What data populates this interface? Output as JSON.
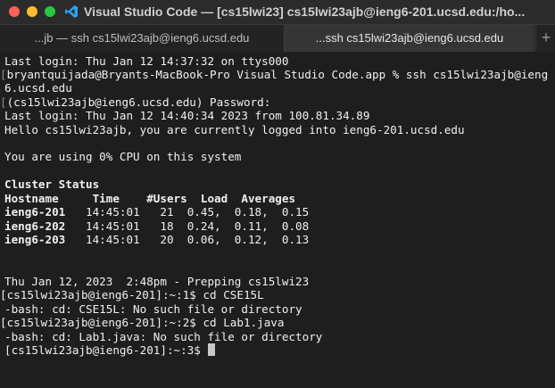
{
  "window": {
    "title": "Visual Studio Code — [cs15lwi23]  cs15lwi23ajb@ieng6-201.ucsd.edu:/ho..."
  },
  "tabs": [
    {
      "label": "...jb — ssh cs15lwi23ajb@ieng6.ucsd.edu",
      "active": false
    },
    {
      "label": "...ssh cs15lwi23ajb@ieng6.ucsd.edu",
      "active": true
    }
  ],
  "tab_add_label": "+",
  "icons": {
    "app": "vscode-icon",
    "add": "plus-icon"
  },
  "colors": {
    "close": "#fe5f57",
    "minimize": "#febc2e",
    "zoom": "#28c840",
    "vscode_blue": "#2f9ff0"
  },
  "terminal": {
    "lines": [
      {
        "text": "Last login: Thu Jan 12 14:37:32 on ttys000"
      },
      {
        "text": "bryantquijada@Bryants-MacBook-Pro Visual Studio Code.app % ssh cs15lwi23ajb@ieng",
        "mark": "["
      },
      {
        "text": "6.ucsd.edu"
      },
      {
        "text": "(cs15lwi23ajb@ieng6.ucsd.edu) Password:",
        "mark": "["
      },
      {
        "text": "Last login: Thu Jan 12 14:40:34 2023 from 100.81.34.89"
      },
      {
        "text": "Hello cs15lwi23ajb, you are currently logged into ieng6-201.ucsd.edu"
      },
      {
        "text": ""
      },
      {
        "text": "You are using 0% CPU on this system"
      },
      {
        "text": ""
      },
      {
        "text": "Cluster Status",
        "bold": true
      },
      {
        "text": "Hostname     Time    #Users  Load  Averages",
        "bold": true
      },
      {
        "text": "ieng6-201",
        "bold": true,
        "rest": "   14:45:01   21  0.45,  0.18,  0.15"
      },
      {
        "text": "ieng6-202",
        "bold": true,
        "rest": "   14:45:01   18  0.24,  0.11,  0.08"
      },
      {
        "text": "ieng6-203",
        "bold": true,
        "rest": "   14:45:01   20  0.06,  0.12,  0.13"
      },
      {
        "text": ""
      },
      {
        "text": ""
      },
      {
        "text": "Thu Jan 12, 2023  2:48pm - Prepping cs15lwi23"
      },
      {
        "text": "[cs15lwi23ajb@ieng6-201]:~:1$ cd CSE15L",
        "mark": "["
      },
      {
        "text": "-bash: cd: CSE15L: No such file or directory"
      },
      {
        "text": "[cs15lwi23ajb@ieng6-201]:~:2$ cd Lab1.java",
        "mark": "["
      },
      {
        "text": "-bash: cd: Lab1.java: No such file or directory"
      },
      {
        "text": "[cs15lwi23ajb@ieng6-201]:~:3$ ",
        "cursor": true
      }
    ]
  }
}
